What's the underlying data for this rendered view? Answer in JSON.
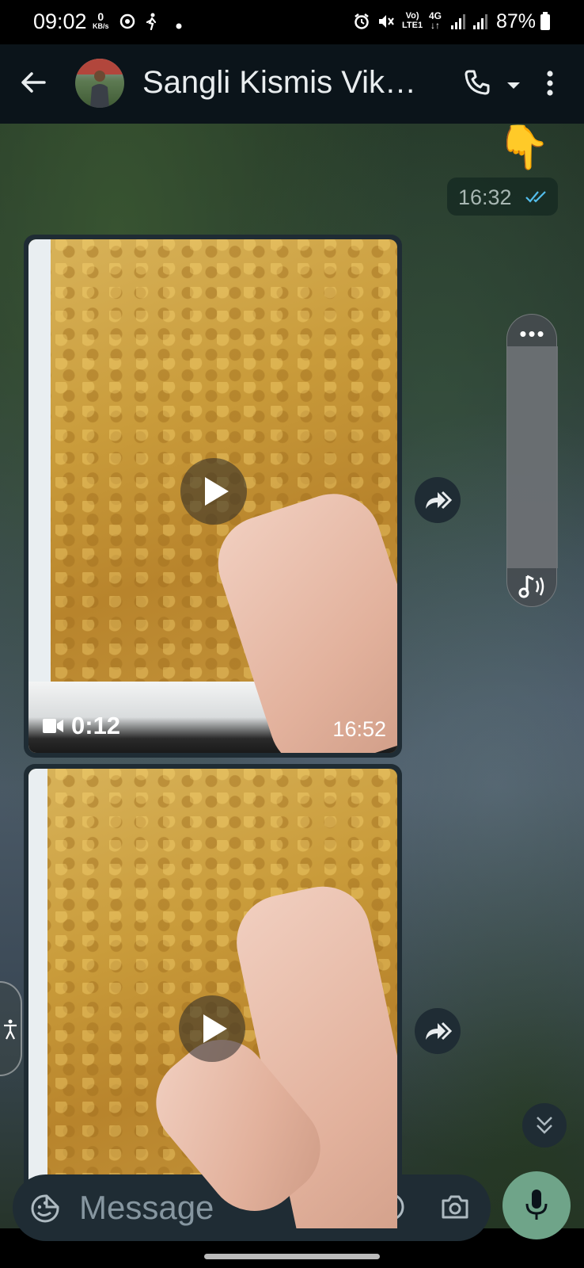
{
  "status_bar": {
    "time": "09:02",
    "net_speed_value": "0",
    "net_speed_unit": "KB/s",
    "network": "4G",
    "sim_label": "LTE1",
    "volte_label": "Vo)",
    "battery": "87%"
  },
  "header": {
    "title": "Sangli Kismis Vik…"
  },
  "messages": {
    "sent_emoji": "👇",
    "sent_time": "16:32",
    "video1_duration": "0:12",
    "video1_time": "16:52"
  },
  "composer": {
    "placeholder": "Message"
  },
  "colors": {
    "header_bg": "#0b141a",
    "bubble_bg": "#1f2c34",
    "mic_button": "#6fa489",
    "read_ticks": "#53bdeb"
  },
  "icons": [
    "back-arrow-icon",
    "voice-call-icon",
    "chevron-down-icon",
    "more-vert-icon",
    "play-icon",
    "video-camera-icon",
    "forward-icon",
    "read-ticks-icon",
    "emoji-sticker-icon",
    "attach-icon",
    "rupee-icon",
    "camera-icon",
    "mic-icon",
    "accessibility-icon",
    "double-chevron-down-icon",
    "music-note-icon"
  ]
}
